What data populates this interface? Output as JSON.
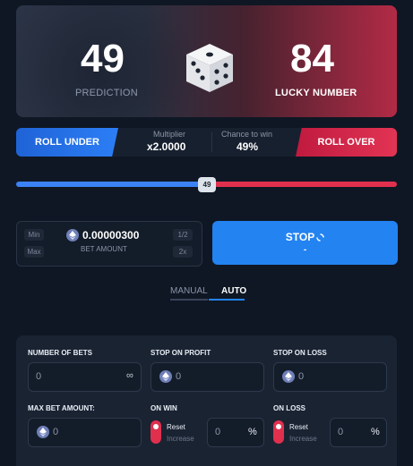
{
  "hero": {
    "prediction_value": "49",
    "prediction_label": "PREDICTION",
    "lucky_value": "84",
    "lucky_label": "LUCKY NUMBER"
  },
  "controls": {
    "roll_under": "ROLL UNDER",
    "roll_over": "ROLL OVER",
    "multiplier_label": "Multiplier",
    "multiplier_value": "x2.0000",
    "chance_label": "Chance to win",
    "chance_value": "49%"
  },
  "slider": {
    "value": 49,
    "thumb_text": "49"
  },
  "bet": {
    "min": "Min",
    "max": "Max",
    "half": "1/2",
    "double": "2x",
    "amount": "0.00000300",
    "label": "BET AMOUNT",
    "stop_label": "STOP",
    "stop_sub": "-"
  },
  "tabs": {
    "manual": "MANUAL",
    "auto": "AUTO"
  },
  "auto": {
    "number_of_bets_label": "NUMBER OF BETS",
    "number_of_bets_value": "0",
    "infinity": "∞",
    "stop_profit_label": "STOP ON PROFIT",
    "stop_profit_value": "0",
    "stop_loss_label": "STOP ON LOSS",
    "stop_loss_value": "0",
    "max_bet_label": "MAX BET AMOUNT:",
    "max_bet_value": "0",
    "on_win_label": "ON WIN",
    "on_win_reset": "Reset",
    "on_win_increase": "Increase",
    "on_win_value": "0",
    "on_loss_label": "ON LOSS",
    "on_loss_reset": "Reset",
    "on_loss_increase": "Increase",
    "on_loss_value": "0",
    "percent": "%"
  },
  "colors": {
    "blue": "#2383f0",
    "red": "#e0304e",
    "panel": "#1a2332",
    "background": "#0f1724"
  }
}
